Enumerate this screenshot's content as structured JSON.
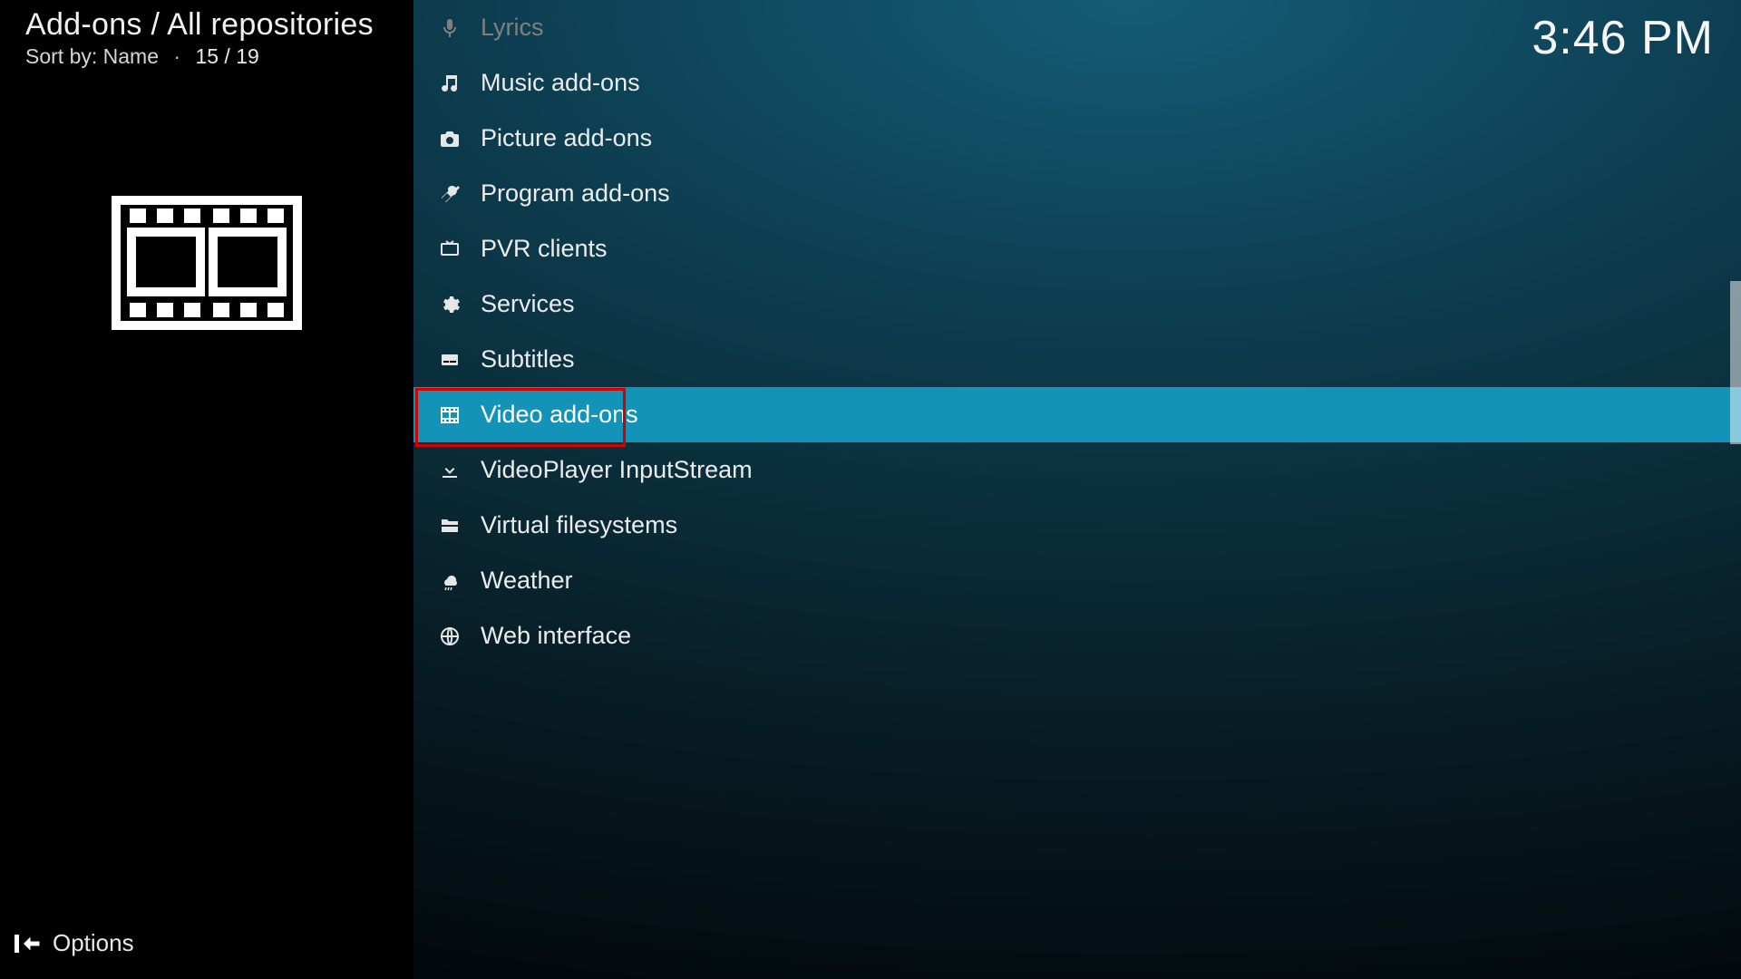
{
  "header": {
    "breadcrumb": "Add-ons / All repositories",
    "sort_label": "Sort by: Name",
    "sort_separator": "·",
    "position": "15 / 19",
    "clock": "3:46 PM"
  },
  "footer": {
    "options_label": "Options"
  },
  "list": [
    {
      "label": "Lyrics",
      "icon": "microphone-icon",
      "disabled": true,
      "selected": false
    },
    {
      "label": "Music add-ons",
      "icon": "music-note-icon",
      "disabled": false,
      "selected": false
    },
    {
      "label": "Picture add-ons",
      "icon": "camera-icon",
      "disabled": false,
      "selected": false
    },
    {
      "label": "Program add-ons",
      "icon": "tools-icon",
      "disabled": false,
      "selected": false
    },
    {
      "label": "PVR clients",
      "icon": "tv-icon",
      "disabled": false,
      "selected": false
    },
    {
      "label": "Services",
      "icon": "gear-icon",
      "disabled": false,
      "selected": false
    },
    {
      "label": "Subtitles",
      "icon": "subtitles-icon",
      "disabled": false,
      "selected": false
    },
    {
      "label": "Video add-ons",
      "icon": "film-icon",
      "disabled": false,
      "selected": true,
      "highlight": true
    },
    {
      "label": "VideoPlayer InputStream",
      "icon": "download-icon",
      "disabled": false,
      "selected": false
    },
    {
      "label": "Virtual filesystems",
      "icon": "folder-tree-icon",
      "disabled": false,
      "selected": false
    },
    {
      "label": "Weather",
      "icon": "weather-icon",
      "disabled": false,
      "selected": false
    },
    {
      "label": "Web interface",
      "icon": "globe-icon",
      "disabled": false,
      "selected": false
    }
  ],
  "colors": {
    "selected_row_bg": "#1393b8",
    "highlight_border": "#d40000"
  }
}
